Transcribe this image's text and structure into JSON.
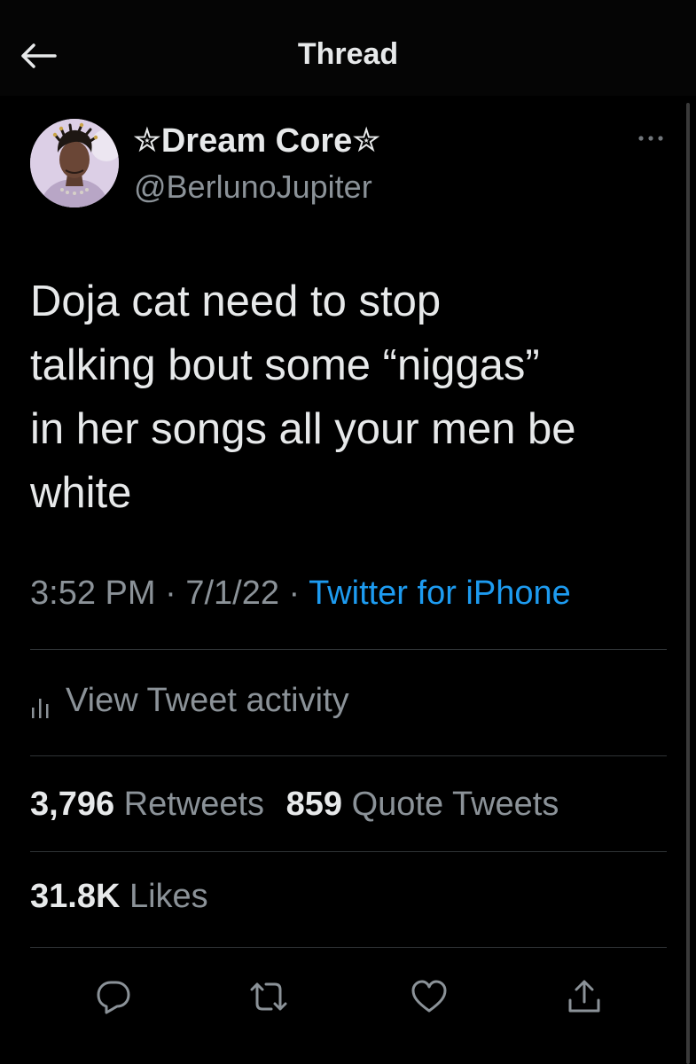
{
  "header": {
    "title": "Thread",
    "back_icon": "arrow-left-icon"
  },
  "tweet": {
    "display_name": "✮Dream Core✮",
    "handle": "@BerlunoJupiter",
    "text": "Doja cat need to stop\ntalking bout some “niggas”\nin her songs all your men be\nwhite",
    "time": "3:52 PM",
    "date": "7/1/22",
    "separator": "·",
    "source": "Twitter for iPhone",
    "activity_label": "View Tweet activity",
    "retweets_count": "3,796",
    "retweets_label": "Retweets",
    "quotes_count": "859",
    "quotes_label": "Quote Tweets",
    "likes_count": "31.8K",
    "likes_label": "Likes"
  },
  "actions": [
    "reply-icon",
    "retweet-icon",
    "like-icon",
    "share-icon"
  ],
  "colors": {
    "background": "#000000",
    "text_primary": "#e7e9ea",
    "text_secondary": "#8b9298",
    "accent": "#1d9bf0",
    "divider": "#2f3336"
  }
}
